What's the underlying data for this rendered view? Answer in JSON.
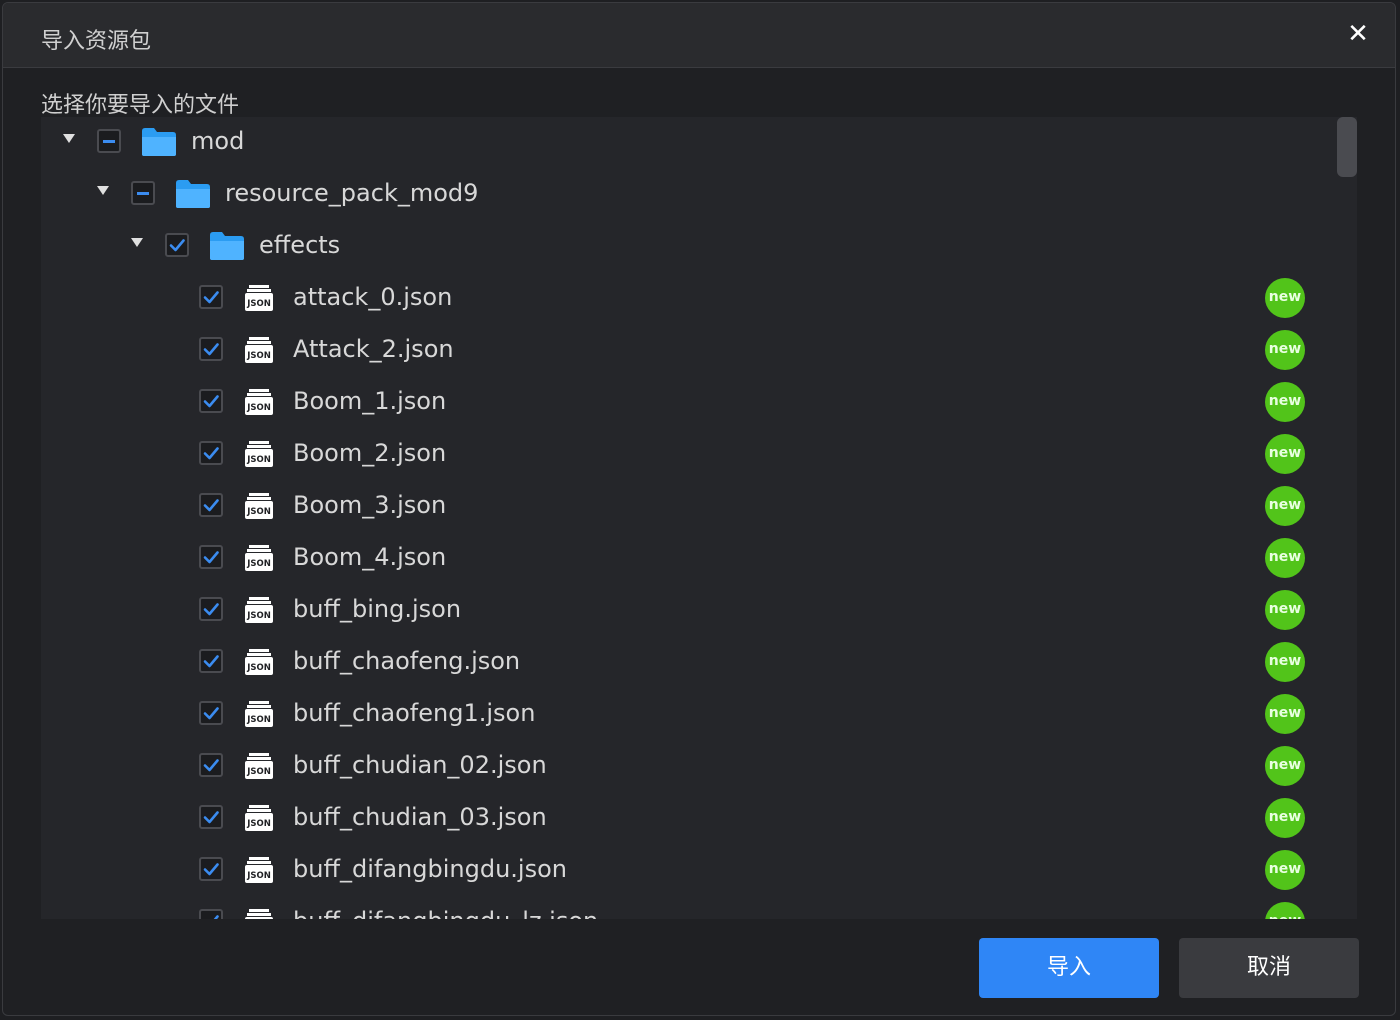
{
  "dialog": {
    "title": "导入资源包",
    "close_glyph": "✕",
    "subtitle": "选择你要导入的文件"
  },
  "tree": {
    "folders": [
      {
        "label": "mod",
        "state": "indeterminate",
        "expanded": true
      },
      {
        "label": "resource_pack_mod9",
        "state": "indeterminate",
        "expanded": true
      },
      {
        "label": "effects",
        "state": "checked",
        "expanded": true
      }
    ],
    "files": [
      {
        "label": "attack_0.json",
        "badge": "new",
        "checked": true
      },
      {
        "label": "Attack_2.json",
        "badge": "new",
        "checked": true
      },
      {
        "label": "Boom_1.json",
        "badge": "new",
        "checked": true
      },
      {
        "label": "Boom_2.json",
        "badge": "new",
        "checked": true
      },
      {
        "label": "Boom_3.json",
        "badge": "new",
        "checked": true
      },
      {
        "label": "Boom_4.json",
        "badge": "new",
        "checked": true
      },
      {
        "label": "buff_bing.json",
        "badge": "new",
        "checked": true
      },
      {
        "label": "buff_chaofeng.json",
        "badge": "new",
        "checked": true
      },
      {
        "label": "buff_chaofeng1.json",
        "badge": "new",
        "checked": true
      },
      {
        "label": "buff_chudian_02.json",
        "badge": "new",
        "checked": true
      },
      {
        "label": "buff_chudian_03.json",
        "badge": "new",
        "checked": true
      },
      {
        "label": "buff_difangbingdu.json",
        "badge": "new",
        "checked": true
      },
      {
        "label": "buff_difangbingdu_lz.json",
        "badge": "new",
        "checked": true
      }
    ],
    "file_icon_text": "JSON"
  },
  "buttons": {
    "import_label": "导入",
    "cancel_label": "取消"
  },
  "colors": {
    "accent": "#2f86f6",
    "badge_green": "#52c41a",
    "folder_blue": "#2b9cf2"
  }
}
